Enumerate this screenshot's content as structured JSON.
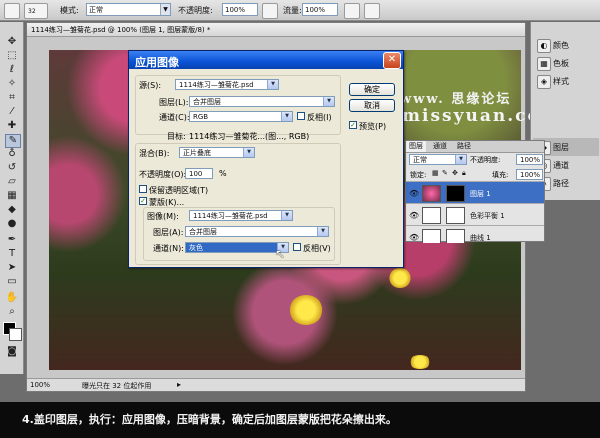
{
  "options_bar": {
    "brush_size": "32",
    "mode_label": "模式:",
    "mode_value": "正常",
    "opacity_label": "不透明度:",
    "opacity_value": "100%",
    "flow_label": "流量:",
    "flow_value": "100%"
  },
  "document": {
    "tab_title": "1114练习—雏菊花.psd @ 100% (图层 1, 图层蒙版/8) *",
    "zoom": "100%",
    "status_text": "曝光只在 32 位起作用"
  },
  "watermark": {
    "line1": "www. 思缘论坛",
    "line2": "missyuan.com"
  },
  "dialog": {
    "title": "应用图像",
    "source_label": "源(S):",
    "source_value": "1114练习—雏菊花.psd",
    "layer_label": "图层(L):",
    "layer_value": "合并图层",
    "channel_label": "通道(C):",
    "channel_value": "RGB",
    "invert_label": "反相(I)",
    "target_label": "目标:",
    "target_value": "1114练习—雏菊花...(图..., RGB)",
    "blending_label": "混合(B):",
    "blending_value": "正片叠底",
    "opacity_label": "不透明度(O):",
    "opacity_value": "100",
    "opacity_unit": "%",
    "preserve_label": "保留透明区域(T)",
    "mask_label": "蒙版(K)...",
    "mask_image_label": "图像(M):",
    "mask_image_value": "1114练习—雏菊花.psd",
    "mask_layer_label": "图层(A):",
    "mask_layer_value": "合并图层",
    "mask_channel_label": "通道(N):",
    "mask_channel_value": "灰色",
    "mask_invert_label": "反相(V)",
    "ok_label": "确定",
    "cancel_label": "取消",
    "preview_label": "预览(P)"
  },
  "dock": {
    "items": [
      {
        "label": "颜色",
        "icon": "color-icon"
      },
      {
        "label": "色板",
        "icon": "swatches-icon"
      },
      {
        "label": "样式",
        "icon": "styles-icon"
      },
      {
        "label": "图层",
        "icon": "layers-icon"
      },
      {
        "label": "通道",
        "icon": "channels-icon"
      },
      {
        "label": "路径",
        "icon": "paths-icon"
      }
    ]
  },
  "layers_panel": {
    "tabs": [
      "图层",
      "通道",
      "路径"
    ],
    "blend_value": "正常",
    "opacity_label": "不透明度:",
    "opacity_value": "100%",
    "lock_label": "锁定:",
    "fill_label": "填充:",
    "fill_value": "100%",
    "layers": [
      {
        "name": "图层 1"
      },
      {
        "name": "色彩平衡 1"
      },
      {
        "name": "曲线 1"
      }
    ]
  },
  "caption": "4.盖印图层，执行：应用图像，压暗背景，确定后加图层蒙版把花朵擦出来。",
  "colors": {
    "title_bar": "#0a53d6",
    "selection": "#316ac5",
    "close_button": "#c8411a"
  }
}
